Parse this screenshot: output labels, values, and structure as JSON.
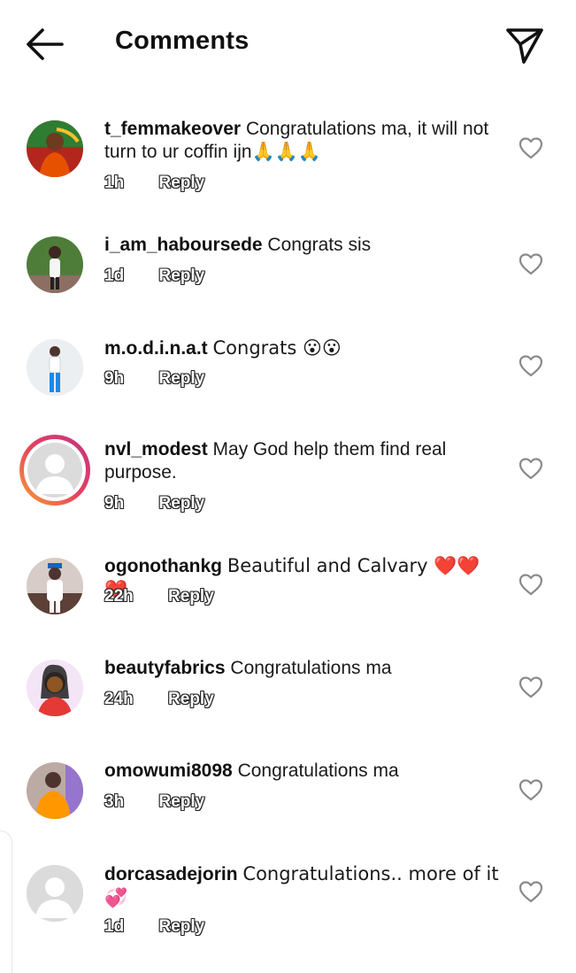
{
  "header": {
    "title": "Comments"
  },
  "comments": [
    {
      "username": "t_femmakeover",
      "text": "Congratulations ma, it will not turn to ur coffin ijn🙏🙏🙏",
      "time": "1h",
      "reply": "Reply"
    },
    {
      "username": "i_am_haboursede",
      "text": "Congrats sis",
      "time": "1d",
      "reply": "Reply"
    },
    {
      "username": "m.o.d.i.n.a.t",
      "text": "Congrats 😮😮",
      "time": "9h",
      "reply": "Reply"
    },
    {
      "username": "nvl_modest",
      "text": "May God help them find real purpose.",
      "time": "9h",
      "reply": "Reply"
    },
    {
      "username": "ogonothankg",
      "text": "Beautiful and Calvary ❤️❤️❤️",
      "time": "22h",
      "reply": "Reply"
    },
    {
      "username": "beautyfabrics",
      "text": "Congratulations ma",
      "time": "24h",
      "reply": "Reply"
    },
    {
      "username": "omowumi8098",
      "text": "Congratulations ma",
      "time": "3h",
      "reply": "Reply"
    },
    {
      "username": "dorcasadejorin",
      "text": "Congratulations.. more of it 💞",
      "time": "1d",
      "reply": "Reply"
    }
  ],
  "icons": {
    "back": "arrow-left-icon",
    "send": "paper-plane-icon",
    "like": "heart-outline-icon"
  },
  "colors": {
    "story_ring_start": "#f7a233",
    "story_ring_mid": "#e4405f",
    "story_ring_end": "#c13584"
  }
}
